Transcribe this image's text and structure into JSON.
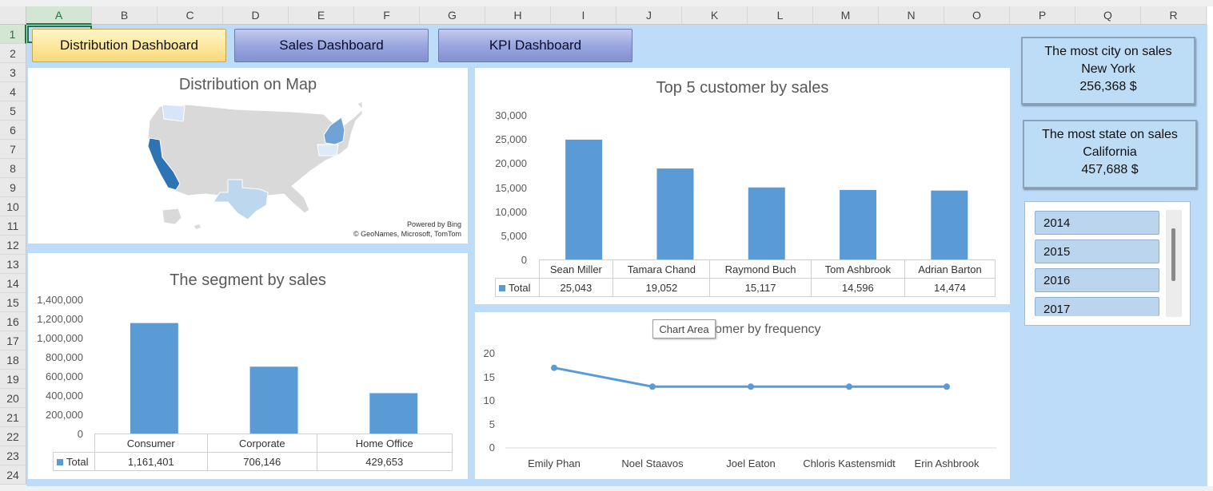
{
  "columns": [
    "A",
    "B",
    "C",
    "D",
    "E",
    "F",
    "G",
    "H",
    "I",
    "J",
    "K",
    "L",
    "M",
    "N",
    "O",
    "P",
    "Q",
    "R"
  ],
  "rows": [
    "1",
    "2",
    "3",
    "4",
    "5",
    "6",
    "7",
    "8",
    "9",
    "10",
    "11",
    "12",
    "13",
    "14",
    "15",
    "16",
    "17",
    "18",
    "19",
    "20",
    "21",
    "22",
    "23",
    "24"
  ],
  "nav": {
    "distribution": "Distribution Dashboard",
    "sales": "Sales Dashboard",
    "kpi": "KPI Dashboard"
  },
  "map": {
    "title": "Distribution on Map",
    "powered": "Powered by Bing",
    "credit": "© GeoNames, Microsoft, TomTom"
  },
  "cards": {
    "city_title": "The most city on sales",
    "city_value": "New York",
    "city_amount": "256,368  $",
    "state_title": "The most state on sales",
    "state_value": "California",
    "state_amount": "457,688 $"
  },
  "slicer": {
    "items": [
      "2014",
      "2015",
      "2016",
      "2017"
    ]
  },
  "tooltip": "Chart Area",
  "legend_total": "Total",
  "colors": {
    "bar": "#5b9bd5",
    "accent_green": "#217346"
  },
  "chart_data": [
    {
      "type": "bar",
      "title": "Top 5 customer by sales",
      "categories": [
        "Sean Miller",
        "Tamara Chand",
        "Raymond Buch",
        "Tom Ashbrook",
        "Adrian Barton"
      ],
      "values": [
        25043,
        19052,
        15117,
        14596,
        14474
      ],
      "value_labels": [
        "25,043",
        "19,052",
        "15,117",
        "14,596",
        "14,474"
      ],
      "yticks": [
        "0",
        "5,000",
        "10,000",
        "15,000",
        "20,000",
        "25,000",
        "30,000"
      ],
      "ylim": [
        0,
        30000
      ],
      "series": [
        {
          "name": "Total",
          "values": [
            25043,
            19052,
            15117,
            14596,
            14474
          ]
        }
      ]
    },
    {
      "type": "bar",
      "title": "The segment by sales",
      "categories": [
        "Consumer",
        "Corporate",
        "Home Office"
      ],
      "values": [
        1161401,
        706146,
        429653
      ],
      "value_labels": [
        "1,161,401",
        "706,146",
        "429,653"
      ],
      "yticks": [
        "0",
        "200,000",
        "400,000",
        "600,000",
        "800,000",
        "1,000,000",
        "1,200,000",
        "1,400,000"
      ],
      "ylim": [
        0,
        1400000
      ],
      "series": [
        {
          "name": "Total",
          "values": [
            1161401,
            706146,
            429653
          ]
        }
      ]
    },
    {
      "type": "line",
      "title": "omer by frequency",
      "categories": [
        "Emily Phan",
        "Noel Staavos",
        "Joel Eaton",
        "Chloris Kastensmidt",
        "Erin Ashbrook"
      ],
      "values": [
        17,
        13,
        13,
        13,
        13
      ],
      "yticks": [
        "0",
        "5",
        "10",
        "15",
        "20"
      ],
      "ylim": [
        0,
        20
      ]
    }
  ]
}
